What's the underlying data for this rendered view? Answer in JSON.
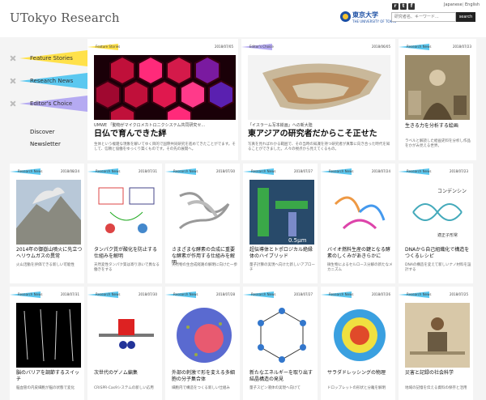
{
  "header": {
    "logo": "UTokyo Research",
    "university": "東京大学",
    "university_en": "THE UNIVERSITY OF TOKYO",
    "lang_ja": "Japanese",
    "lang_en": "English",
    "search_placeholder": "研究者名、キーワード...",
    "search_button": "search",
    "social": {
      "rss": "r",
      "twitter": "t",
      "facebook": "f"
    }
  },
  "nav": {
    "items": [
      {
        "label": "Feature Stories",
        "color": "#ffe14a"
      },
      {
        "label": "Research News",
        "color": "#5bc8f0"
      },
      {
        "label": "Editor's Choice",
        "color": "#b5aaf2"
      }
    ],
    "links": [
      "Discover",
      "Newsletter"
    ]
  },
  "colors": {
    "feature": "#ffe14a",
    "news": "#5bc8f0",
    "editor": "#b5aaf2"
  },
  "top_cards": [
    {
      "tag": "Feature Stories",
      "date": "2018/07/05",
      "sub": "UMWE 「動物がマイクロメカトロニクシステム共同研究セ...",
      "title": "日仏で育んできた絆",
      "desc": "生体という複雑な現象を解いてゆく目的で国際共同研究を進めてきたことがでます。そして、信頼と協働をゆっくり築くものです。その先の展開へ。"
    },
    {
      "tag": "Editor's Choice",
      "date": "2018/06/05",
      "sub": "「イスラーム写本絵画」への新大陸",
      "title": "東アジアの研究者だからこそ正せた",
      "desc": "写真を見ればわかる範囲で、その当時の知識を持つ研究者が真摯に向き合った時代を知ることができました。人々の視点から見えてくるもの。"
    },
    {
      "tag": "Research News",
      "date": "2018/07/23",
      "sub": "生きる力を分析する絵画",
      "title": "",
      "desc": "ラベルと解読した絵画史料を分析し作品をかがみ見える世界。"
    }
  ],
  "row2": [
    {
      "tag": "Research News",
      "date": "2018/08/24",
      "title": "2014年の御嶽山噴火に先立つヘリウムガスの異常",
      "desc": "火山活動を評価できる新しい可能性"
    },
    {
      "tag": "Research News",
      "date": "2018/07/31",
      "title": "タンパク質が酸化を防止する仕組みを解明",
      "desc": "天然変性タンパク質は寄り添いで異なる働きをする"
    },
    {
      "tag": "Research News",
      "date": "2018/07/30",
      "title": "さまざまな酵素の合成に重要な酵素が作用する仕組みを解明",
      "desc": "天然物の生合成経路の解明に向けた一歩"
    },
    {
      "tag": "Research News",
      "date": "2018/07/27",
      "title": "超伝導体とトポロジカル絶縁体のハイブリッド",
      "desc": "量子計算の実現へ向けた新しいアプローチ"
    },
    {
      "tag": "Research News",
      "date": "2018/07/24",
      "title": "バイオ燃料生産の鍵となる酵素のしくみがあきらかに",
      "desc": "微生物によるセルロース分解の新たなメカニズム"
    },
    {
      "tag": "Research News",
      "date": "2018/07/23",
      "title": "DNAから自己組織化で構造をつくるレシピ",
      "desc": "DNAの構造を変えて新しいナノ材料を設計する"
    }
  ],
  "row3": [
    {
      "tag": "Research News",
      "date": "2018/07/31",
      "title": "脳のバリアを調節するスイッチ",
      "desc": "脳血管の内皮細胞が脳の状態で変化"
    },
    {
      "tag": "Research News",
      "date": "2018/07/30",
      "title": "次世代のゲノム編集",
      "desc": "CRISPR-Cas9システムの新しい応用"
    },
    {
      "tag": "Research News",
      "date": "2018/07/28",
      "title": "外部の刺激で形を変える多細胞の分子集合体",
      "desc": "細胞内で構造をつくる新しい仕組み"
    },
    {
      "tag": "Research News",
      "date": "2018/07/27",
      "title": "新たなエネルギーを取り出す結晶構造の発見",
      "desc": "量子スピン液体の実現へ向けて"
    },
    {
      "tag": "Research News",
      "date": "2018/07/26",
      "title": "サラダドレッシングの物理",
      "desc": "ドロップレットの形状と分離を解明"
    },
    {
      "tag": "Research News",
      "date": "2018/07/25",
      "title": "災害と記録の社会科学",
      "desc": "地域の記憶を伝える資料の保存と活用"
    }
  ]
}
